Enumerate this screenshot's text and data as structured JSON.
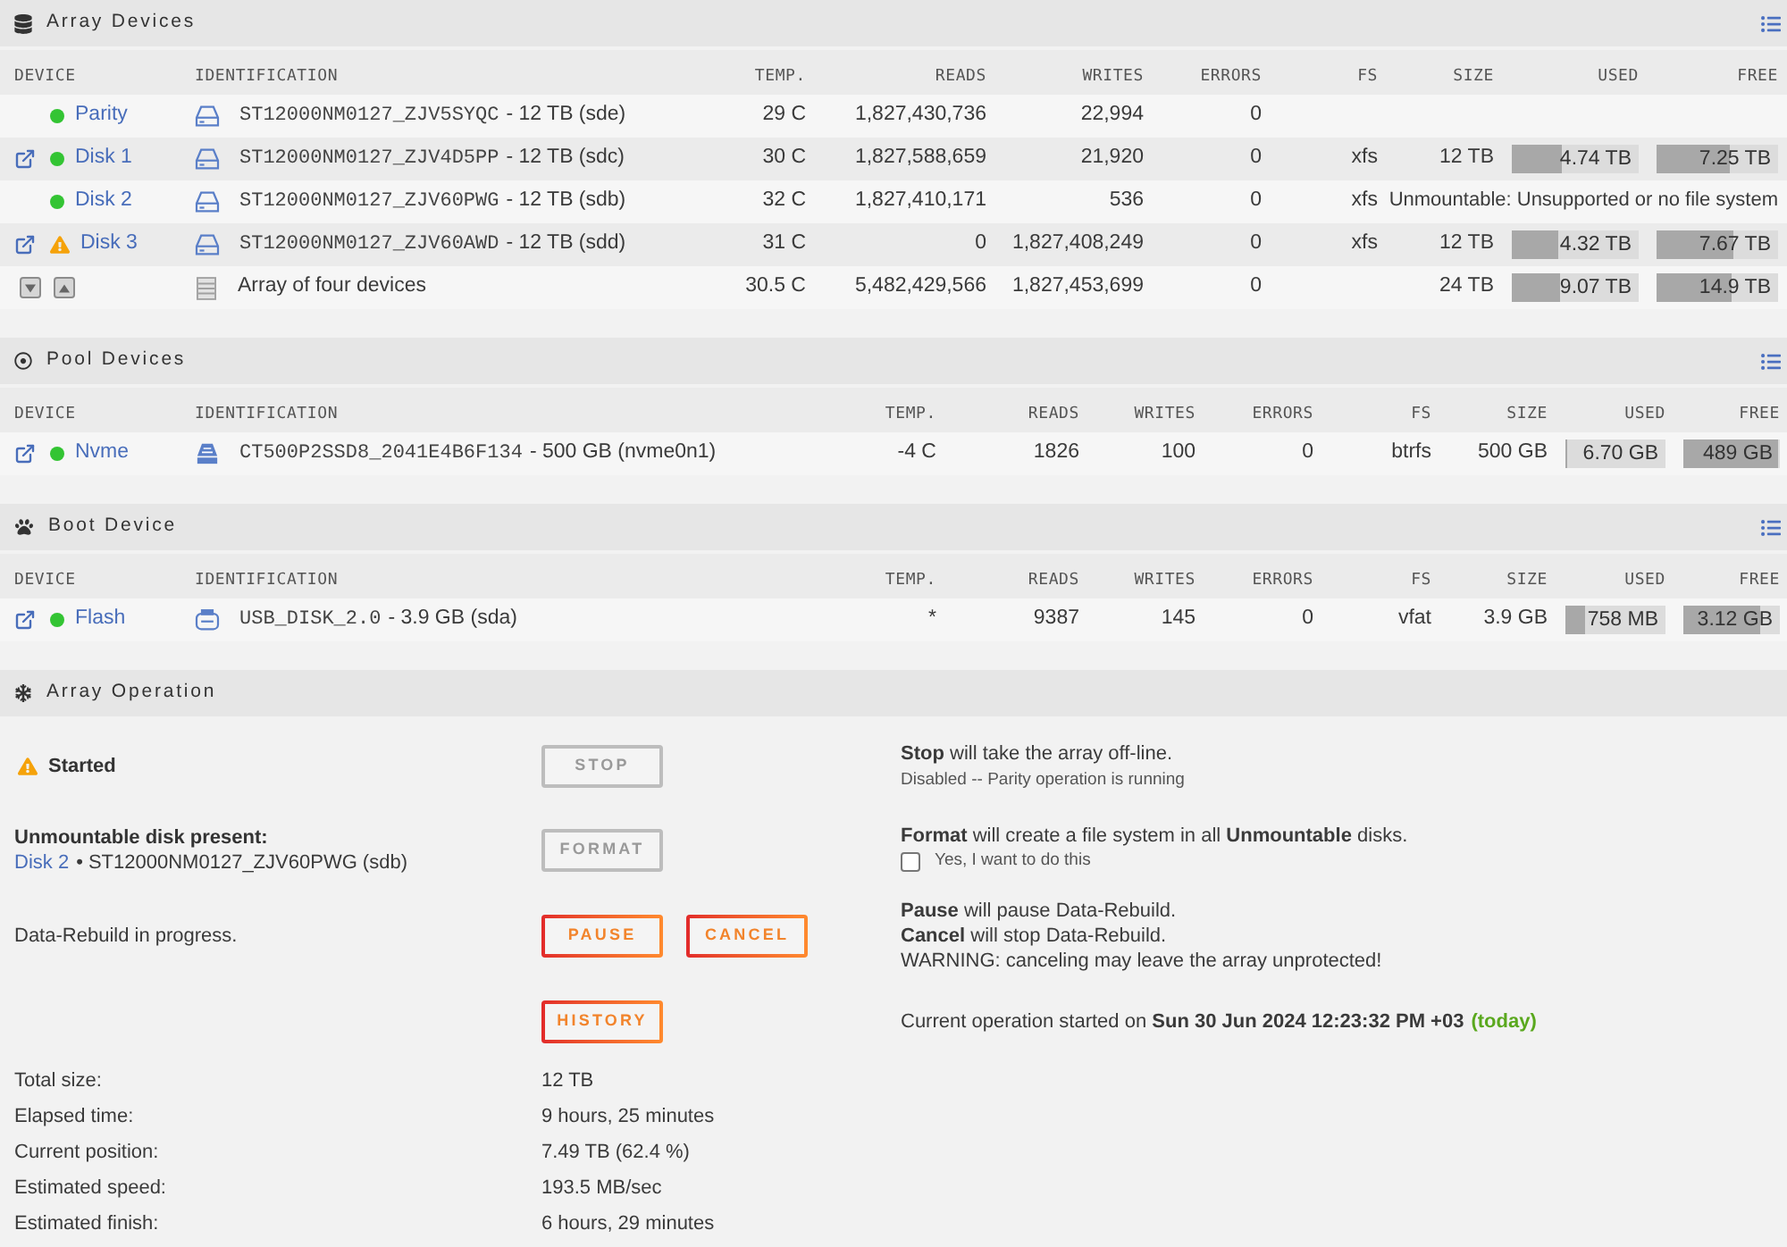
{
  "array_devices": {
    "title": "Array Devices",
    "columns": [
      "DEVICE",
      "IDENTIFICATION",
      "TEMP.",
      "READS",
      "WRITES",
      "ERRORS",
      "FS",
      "SIZE",
      "USED",
      "FREE"
    ],
    "rows": [
      {
        "device": "Parity",
        "warning": false,
        "open_link": false,
        "kind": "hdd",
        "model": "ST12000NM0127_ZJV5SYQC",
        "detail": "- 12 TB (sde)",
        "temp": "29 C",
        "reads": "1,827,430,736",
        "writes": "22,994",
        "errors": "0"
      },
      {
        "device": "Disk 1",
        "warning": false,
        "open_link": true,
        "kind": "hdd",
        "model": "ST12000NM0127_ZJV4D5PP",
        "detail": "- 12 TB (sdc)",
        "temp": "30 C",
        "reads": "1,827,588,659",
        "writes": "21,920",
        "errors": "0",
        "fs": "xfs",
        "size": "12 TB",
        "used": {
          "text": "4.74 TB",
          "level": 0.395
        },
        "free": {
          "text": "7.25 TB",
          "level": 0.604
        }
      },
      {
        "device": "Disk 2",
        "warning": false,
        "open_link": false,
        "kind": "hdd",
        "model": "ST12000NM0127_ZJV60PWG",
        "detail": "- 12 TB (sdb)",
        "temp": "32 C",
        "reads": "1,827,410,171",
        "writes": "536",
        "errors": "0",
        "fs": "xfs",
        "note": "Unmountable: Unsupported or no file system"
      },
      {
        "device": "Disk 3",
        "warning": true,
        "open_link": true,
        "kind": "hdd",
        "model": "ST12000NM0127_ZJV60AWD",
        "detail": "- 12 TB (sdd)",
        "temp": "31 C",
        "reads": "0",
        "writes": "1,827,408,249",
        "errors": "0",
        "fs": "xfs",
        "size": "12 TB",
        "used": {
          "text": "4.32 TB",
          "level": 0.36
        },
        "free": {
          "text": "7.67 TB",
          "level": 0.639
        }
      }
    ],
    "totals": {
      "label": "Array of four devices",
      "temp": "30.5 C",
      "reads": "5,482,429,566",
      "writes": "1,827,453,699",
      "errors": "0",
      "size": "24 TB",
      "used": {
        "text": "9.07 TB",
        "level": 0.378
      },
      "free": {
        "text": "14.9 TB",
        "level": 0.621
      }
    }
  },
  "pool_devices": {
    "title": "Pool Devices",
    "columns": [
      "DEVICE",
      "IDENTIFICATION",
      "TEMP.",
      "READS",
      "WRITES",
      "ERRORS",
      "FS",
      "SIZE",
      "USED",
      "FREE"
    ],
    "rows": [
      {
        "device": "Nvme",
        "warning": false,
        "open_link": true,
        "kind": "nvme",
        "model": "CT500P2SSD8_2041E4B6F134",
        "detail": "- 500 GB (nvme0n1)",
        "temp": "-4 C",
        "reads": "1826",
        "writes": "100",
        "errors": "0",
        "fs": "btrfs",
        "size": "500 GB",
        "used": {
          "text": "6.70 GB",
          "level": 0.013
        },
        "free": {
          "text": "489 GB",
          "level": 0.978
        }
      }
    ]
  },
  "boot_device": {
    "title": "Boot Device",
    "columns": [
      "DEVICE",
      "IDENTIFICATION",
      "TEMP.",
      "READS",
      "WRITES",
      "ERRORS",
      "FS",
      "SIZE",
      "USED",
      "FREE"
    ],
    "rows": [
      {
        "device": "Flash",
        "warning": false,
        "open_link": true,
        "kind": "usb",
        "model": "USB_DISK_2.0",
        "detail": "- 3.9 GB (sda)",
        "temp": "*",
        "reads": "9387",
        "writes": "145",
        "errors": "0",
        "fs": "vfat",
        "size": "3.9 GB",
        "used": {
          "text": "758 MB",
          "level": 0.19
        },
        "free": {
          "text": "3.12 GB",
          "level": 0.8
        }
      }
    ]
  },
  "array_operation": {
    "title": "Array Operation",
    "rows": [
      {
        "kind": "status",
        "warning": true,
        "label": "Started",
        "buttons": [
          {
            "label": "STOP",
            "disabled": true
          }
        ],
        "notes": [
          "**Stop** will take the array off-line."
        ],
        "hint": "Disabled -- Parity operation is running"
      },
      {
        "kind": "disk",
        "label": "Unmountable disk present:",
        "disk_link": "Disk 2",
        "disk_detail": "• ST12000NM0127_ZJV60PWG (sdb)",
        "buttons": [
          {
            "label": "FORMAT",
            "disabled": true
          }
        ],
        "notes": [
          "**Format** will create a file system in all **Unmountable** disks."
        ],
        "confirm": {
          "label": "Yes, I want to do this",
          "checked": false
        }
      },
      {
        "kind": "progress",
        "label": "Data-Rebuild in progress.",
        "buttons": [
          {
            "label": "PAUSE",
            "disabled": false
          },
          {
            "label": "CANCEL",
            "disabled": false
          }
        ],
        "notes": [
          "**Pause** will pause Data-Rebuild.",
          "**Cancel** will stop Data-Rebuild.",
          "WARNING: canceling may leave the array unprotected!"
        ]
      },
      {
        "kind": "history",
        "buttons": [
          {
            "label": "HISTORY",
            "disabled": false
          }
        ],
        "started": "Current operation started on **Sun 30 Jun 2024 12:23:32 PM +03**",
        "started_note": "(today)"
      }
    ],
    "stats": [
      {
        "label": "Total size:",
        "value": "12 TB"
      },
      {
        "label": "Elapsed time:",
        "value": "9 hours, 25 minutes"
      },
      {
        "label": "Current position:",
        "value": "7.49 TB (62.4 %)"
      },
      {
        "label": "Estimated speed:",
        "value": "193.5 MB/sec"
      },
      {
        "label": "Estimated finish:",
        "value": "6 hours, 29 minutes"
      }
    ]
  }
}
